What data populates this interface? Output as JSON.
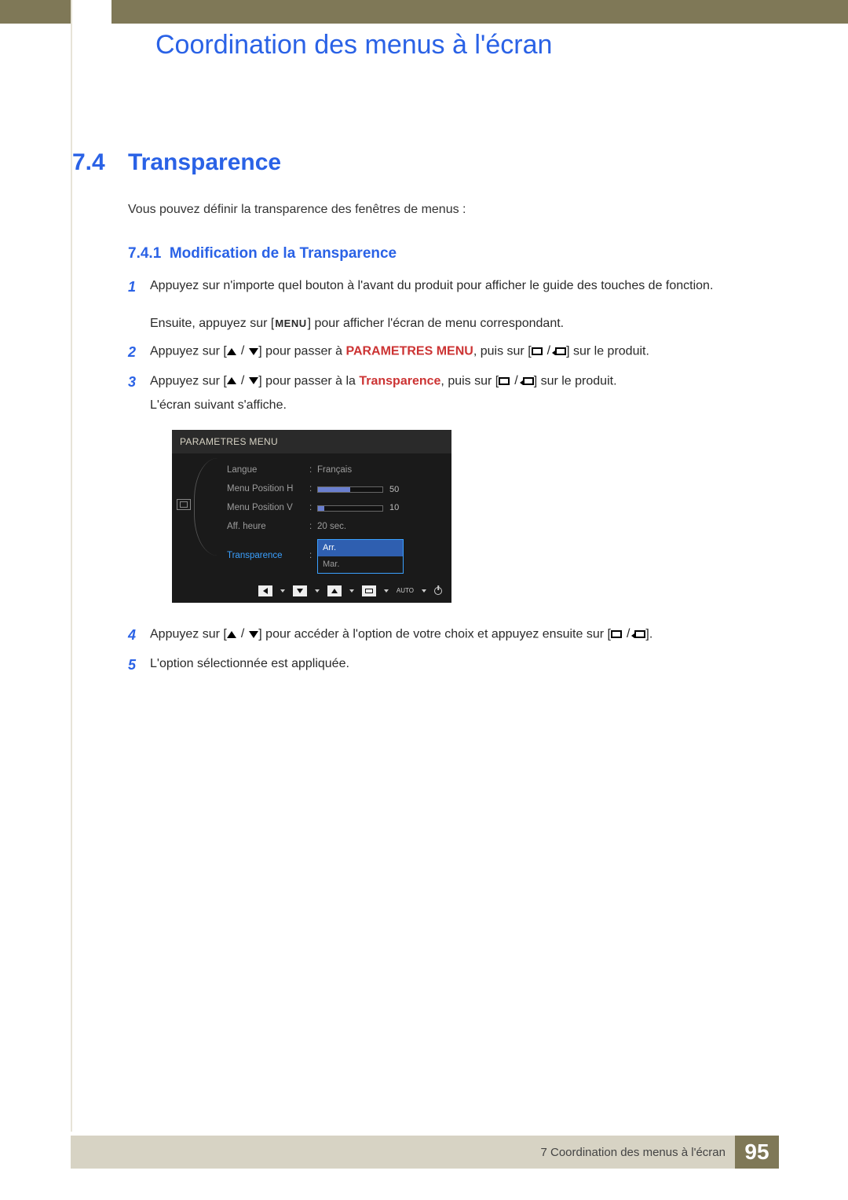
{
  "header": {
    "chapter_title": "Coordination des menus à l'écran"
  },
  "section": {
    "number": "7.4",
    "title": "Transparence",
    "intro": "Vous pouvez définir la transparence des fenêtres de menus :"
  },
  "subsection": {
    "number": "7.4.1",
    "title": "Modification de la Transparence"
  },
  "steps": {
    "s1": "Appuyez sur n'importe quel bouton à l'avant du produit pour afficher le guide des touches de fonction.",
    "s1b_pre": "Ensuite, appuyez sur [",
    "s1b_menu": "MENU",
    "s1b_post": "] pour afficher l'écran de menu correspondant.",
    "s2_pre": "Appuyez sur [",
    "s2_mid": "] pour passer à ",
    "s2_target": "PARAMETRES MENU",
    "s2_mid2": ", puis sur [",
    "s2_post": "] sur le produit.",
    "s3_pre": "Appuyez sur [",
    "s3_mid": "] pour passer à la ",
    "s3_target": "Transparence",
    "s3_mid2": ", puis sur [",
    "s3_post": "] sur le produit.",
    "s3_line2": "L'écran suivant s'affiche.",
    "s4_pre": "Appuyez sur [",
    "s4_mid": "] pour accéder à l'option de votre choix et appuyez ensuite sur [",
    "s4_post": "].",
    "s5": "L'option sélectionnée est appliquée."
  },
  "osd": {
    "title": "PARAMETRES MENU",
    "rows": {
      "langue": {
        "label": "Langue",
        "value": "Français"
      },
      "posh": {
        "label": "Menu Position H",
        "value": 50,
        "fill_pct": 50
      },
      "posv": {
        "label": "Menu Position V",
        "value": 10,
        "fill_pct": 10
      },
      "aff": {
        "label": "Aff. heure",
        "value": "20 sec."
      },
      "trans": {
        "label": "Transparence",
        "selected": "Arr.",
        "option": "Mar."
      }
    },
    "footer_auto": "AUTO"
  },
  "footer": {
    "text": "7 Coordination des menus à l'écran",
    "page": "95"
  }
}
